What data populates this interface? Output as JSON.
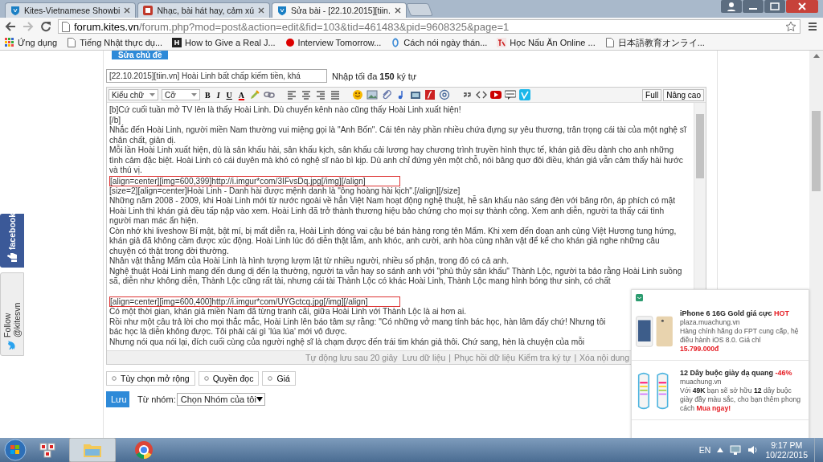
{
  "browser": {
    "tabs": [
      {
        "title": "Kites-Vietnamese Showbi",
        "selected": false,
        "kind": "kites"
      },
      {
        "title": "Nhạc, bài hát hay, cảm xú",
        "selected": false,
        "kind": "music"
      },
      {
        "title": "Sửa bài - [22.10.2015][tiin.",
        "selected": true,
        "kind": "kites"
      }
    ],
    "url": {
      "host": "forum.kites.vn",
      "path": "/forum.php?mod=post&action=edit&fid=103&tid=461483&pid=9608325&page=1"
    },
    "bookmarks": [
      {
        "label": "Ứng dụng",
        "kind": "apps"
      },
      {
        "label": "Tiếng Nhật thực dụ...",
        "kind": "page"
      },
      {
        "label": "How to Give a Real J...",
        "kind": "h"
      },
      {
        "label": "Interview Tomorrow...",
        "kind": "dot"
      },
      {
        "label": "Cách nói ngày thán...",
        "kind": "swirl"
      },
      {
        "label": "Học Nấu Ăn Online ...",
        "kind": "logo"
      },
      {
        "label": "日本語教育オンライ...",
        "kind": "page"
      }
    ]
  },
  "form": {
    "edit_subject_button": "Sửa chủ đề",
    "subject": {
      "value": "[22.10.2015][tiin.vn] Hoài Linh bất chấp kiếm tiền, khá"
    },
    "limit_note": "Nhập tối đa **150** ký tự",
    "toolbar": {
      "style_select": "Kiểu chữ",
      "size_select": "Cỡ",
      "format_buttons": [
        "B",
        "I",
        "U",
        "A"
      ],
      "buttons": [
        "Full",
        "Nâng cao"
      ]
    },
    "lines": [
      {
        "kind": "text",
        "text": "[b]Cứ cuối tuần mở TV lên là thấy Hoài Linh. Dù chuyển kênh nào cũng thấy Hoài Linh xuất hiện!"
      },
      {
        "kind": "text",
        "text": "[/b]"
      },
      {
        "kind": "text",
        "text": "Nhắc đến Hoài Linh, người miền Nam thường vui miệng gọi là \"Anh Bốn\". Cái tên này phần nhiều chứa đựng sự yêu thương, trân trọng cái tài của một nghệ sĩ"
      },
      {
        "kind": "text",
        "text": "chân chất, giản dị."
      },
      {
        "kind": "text",
        "text": "Mỗi lần Hoài Linh xuất hiện, dù là sân khấu hài, sân khấu kịch, sân khấu cải lương hay chương trình truyền hình thực tế, khán giả đều dành cho anh những"
      },
      {
        "kind": "text",
        "text": "tình cảm đặc biệt. Hoài Linh có cái duyên mà khó có nghệ sĩ nào bì kịp. Dù anh chỉ đứng yên một chỗ, nói bâng quơ đôi điều, khán giả vẫn cảm thấy hài hước"
      },
      {
        "kind": "text",
        "text": "và thú vị."
      },
      {
        "kind": "boxed",
        "text": "[align=center][img=600,399]http://i.imgur*com/3IFvsDq.jpg[/img][/align]"
      },
      {
        "kind": "text",
        "text": "[size=2][align=center]Hoài Linh - Danh hài được mệnh danh là \"ông hoàng hài kịch\".[/align][/size]"
      },
      {
        "kind": "text",
        "text": "Những năm 2008 - 2009, khi Hoài Linh mới từ nước ngoài về hẳn Việt Nam hoạt động nghệ thuật, hễ sân khấu nào sáng đèn với băng rôn, áp phích có mặt"
      },
      {
        "kind": "text",
        "text": "Hoài Linh thì khán giả đều tấp nập vào xem. Hoài Linh đã trở thành thương hiệu bảo chứng cho mọi sự thành công. Xem anh diễn, người ta thấy cái tình"
      },
      {
        "kind": "text",
        "text": "người man mác ẩn hiện."
      },
      {
        "kind": "text",
        "text": "Còn nhớ khi liveshow Bí mật, bật mí, bị mất diễn ra, Hoài Linh đóng vai cậu bé bán hàng rong tên Mẩm. Khi xem đến đoạn anh cùng Việt Hương tung hứng,"
      },
      {
        "kind": "text",
        "text": "khán giả đã không cầm được xúc động. Hoài Linh lúc đó diễn thật lắm, anh khóc, anh cười, anh hòa cùng nhân vật để kể cho khán giả nghe những câu"
      },
      {
        "kind": "text",
        "text": "chuyện có thật trong đời thường."
      },
      {
        "kind": "text",
        "text": "Nhân vật thằng Mẩm của Hoài Linh là hình tượng lượm lặt từ nhiều người, nhiều số phận, trong đó có cả anh."
      },
      {
        "kind": "text",
        "text": "Nghệ thuật Hoài Linh mang đến dung dị đến lạ thường, người ta vẫn hay so sánh anh với \"phù thủy sân khấu\" Thành Lộc, người ta bảo rằng Hoài Linh suồng"
      },
      {
        "kind": "text",
        "text": "sã, diễn như không diễn, Thành Lộc cũng rất tài, nhưng cái tài Thành Lộc có khác Hoài Linh, Thành Lộc mang hình bóng thư sinh, có chất"
      },
      {
        "kind": "blank"
      },
      {
        "kind": "boxed",
        "text": "[align=center][img=600,400]http://i.imgur*com/UYGctcq.jpg[/img][/align]"
      },
      {
        "kind": "text",
        "text": "Có một thời gian, khán giả miền Nam đã từng tranh cãi, giữa Hoài Linh với Thành Lộc là ai hơn ai."
      },
      {
        "kind": "text",
        "text": "Rồi như một câu trả lời cho mọi thắc mắc, Hoài Linh lên báo tâm sự rằng: \"Có những vở mang tính bác học, hàn lâm đấy chứ! Nhưng tôi"
      },
      {
        "kind": "text",
        "text": "bác học là diễn không được. Tôi phải cái gì 'lúa lúa' mới vô được."
      },
      {
        "kind": "text",
        "text": "Nhưng nói qua nói lại, đích cuối cùng của người nghệ sĩ là chạm được đến trái tim khán giả thôi. Chứ sang, hèn là chuyện của mỗi"
      }
    ],
    "footer": [
      {
        "text": "Tự động lưu sau 20 giây",
        "kind": "note"
      },
      {
        "text": "Lưu dữ liệu",
        "kind": "link"
      },
      {
        "text": "|",
        "kind": "sep"
      },
      {
        "text": "Phục hồi dữ liệu",
        "kind": "link"
      },
      {
        "text": "Kiểm tra ký tự",
        "kind": "link"
      },
      {
        "text": "|",
        "kind": "sep"
      },
      {
        "text": "Xóa nội dung",
        "kind": "link"
      }
    ],
    "options": [
      "Tùy chọn mở rộng",
      "Quyền đọc",
      "Giá"
    ],
    "save_button": "Lưu",
    "group_label": "Từ nhóm:",
    "group_select": "Chọn Nhóm của tôi"
  },
  "ads": [
    {
      "kind": "phone",
      "title": "iPhone 6 16G Gold giá cực",
      "tag": "HOT",
      "site": "plaza.muachung.vn",
      "description": "Hàng chính hãng do FPT cung cấp, hệ điều hành iOS 8.0. Giá chỉ",
      "price": "15.799.000đ"
    },
    {
      "kind": "shoes",
      "title": "12 Dây buộc giày dạ quang",
      "tag": "-46%",
      "site": "muachung.vn",
      "description": "Với **49K** bạn sẽ sở hữu **12** dây buộc giày đầy màu sắc, cho bạn thêm phong cách",
      "highlight": "Mua ngay!"
    }
  ],
  "social": [
    {
      "label": "facebook",
      "kind": "facebook"
    },
    {
      "label": "Follow @kitesvn",
      "kind": "twitter"
    }
  ],
  "taskbar": {
    "language": "EN",
    "time": "9:17 PM",
    "date": "10/22/2015"
  }
}
